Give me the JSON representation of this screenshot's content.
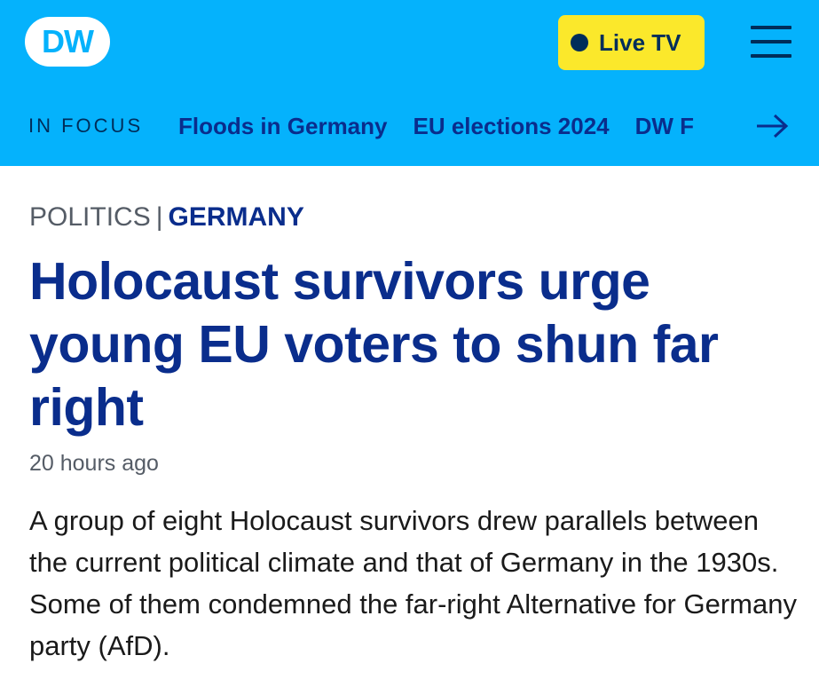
{
  "header": {
    "logo_text": "DW",
    "live_button_label": "Live TV",
    "colors": {
      "header_bg": "#05b2fc",
      "live_button_bg": "#fbe82b",
      "navy": "#002d5a",
      "link_blue": "#0a2d8c"
    }
  },
  "focus_bar": {
    "label": "IN FOCUS",
    "links": [
      {
        "label": "Floods in Germany"
      },
      {
        "label": "EU elections 2024"
      },
      {
        "label": "DW F"
      }
    ],
    "arrow_icon": "arrow-right-icon"
  },
  "article": {
    "section": "POLITICS",
    "separator": "|",
    "country": "GERMANY",
    "headline": "Holocaust survivors urge young EU voters to shun far right",
    "timestamp": "20 hours ago",
    "teaser": "A group of eight Holocaust survivors drew parallels between the current political climate and that of Germany in the 1930s. Some of them condemned the far-right Alternative for Germany party (AfD)."
  }
}
